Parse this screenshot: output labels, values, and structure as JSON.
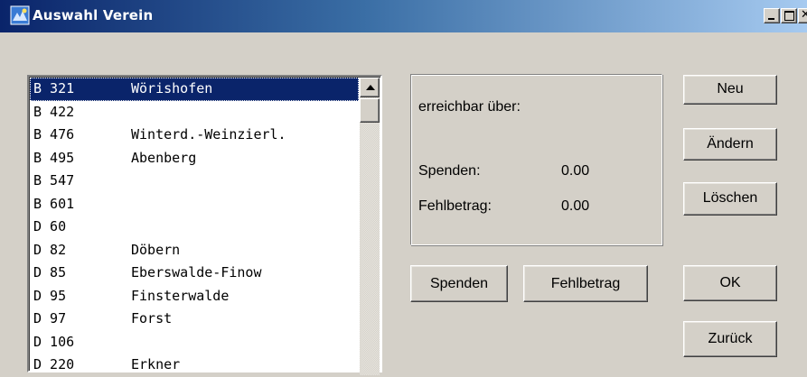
{
  "window": {
    "title": "Auswahl Verein",
    "icon": "app-icon",
    "controls": {
      "minimize": "minimize-icon",
      "maximize": "maximize-icon",
      "close": "close-icon"
    }
  },
  "list": {
    "items": [
      {
        "code": "B 321",
        "name": "Wörishofen",
        "selected": true
      },
      {
        "code": "B 422",
        "name": ""
      },
      {
        "code": "B 476",
        "name": "Winterd.-Weinzierl."
      },
      {
        "code": "B 495",
        "name": "Abenberg"
      },
      {
        "code": "B 547",
        "name": ""
      },
      {
        "code": "B 601",
        "name": ""
      },
      {
        "code": "D 60",
        "name": ""
      },
      {
        "code": "D 82",
        "name": "Döbern"
      },
      {
        "code": "D 85",
        "name": "Eberswalde-Finow"
      },
      {
        "code": "D 95",
        "name": "Finsterwalde"
      },
      {
        "code": "D 97",
        "name": "Forst"
      },
      {
        "code": "D 106",
        "name": ""
      },
      {
        "code": "D 220",
        "name": "Erkner"
      }
    ]
  },
  "info": {
    "reachable_label": "erreichbar über:",
    "donations_label": "Spenden:",
    "donations_value": "0.00",
    "shortfall_label": "Fehlbetrag:",
    "shortfall_value": "0.00"
  },
  "buttons": {
    "new": "Neu",
    "change": "Ändern",
    "delete": "Löschen",
    "donations": "Spenden",
    "shortfall": "Fehlbetrag",
    "ok": "OK",
    "back": "Zurück"
  },
  "colors": {
    "selection": "#0a246a",
    "face": "#d4d0c8",
    "title_start": "#0a246a",
    "title_end": "#a6caf0"
  }
}
